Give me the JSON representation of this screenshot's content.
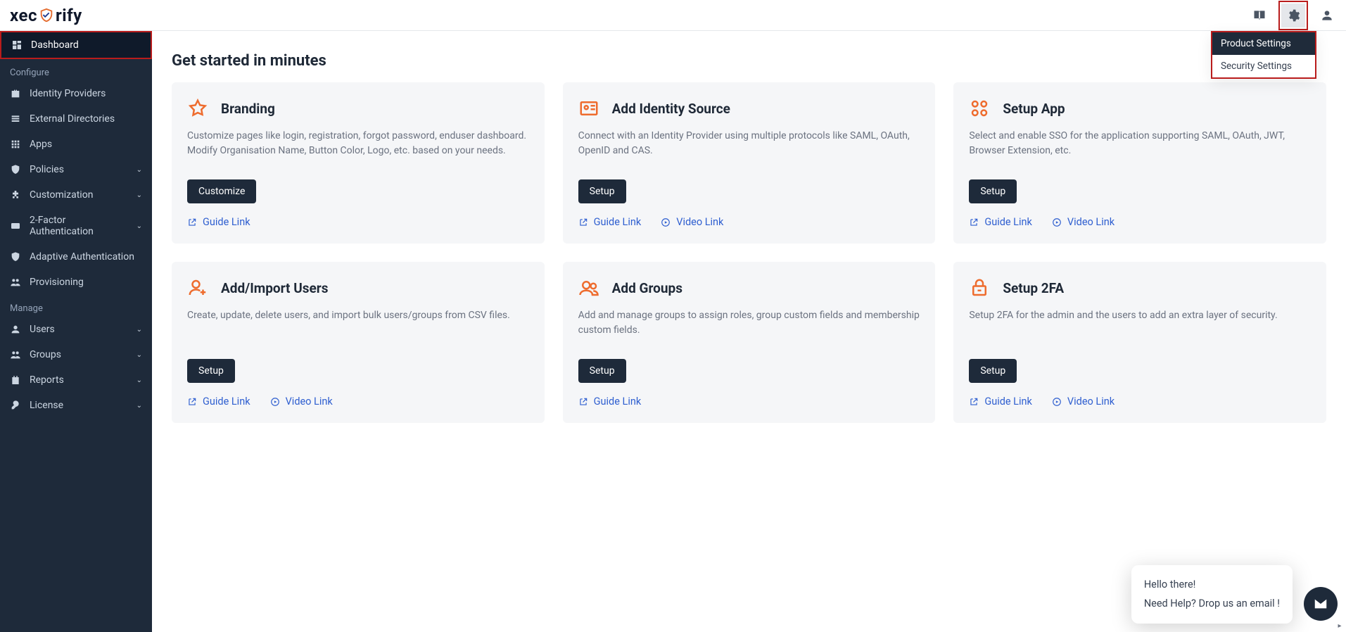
{
  "brand": {
    "name_left": "xec",
    "name_right": "rify"
  },
  "dropdown": {
    "product_settings": "Product Settings",
    "security_settings": "Security Settings"
  },
  "sidebar": {
    "dashboard_label": "Dashboard",
    "section_configure": "Configure",
    "identity_providers": "Identity Providers",
    "external_directories": "External Directories",
    "apps": "Apps",
    "policies": "Policies",
    "customization": "Customization",
    "two_factor": "2-Factor Authentication",
    "adaptive_auth": "Adaptive Authentication",
    "provisioning": "Provisioning",
    "section_manage": "Manage",
    "users": "Users",
    "groups": "Groups",
    "reports": "Reports",
    "license": "License"
  },
  "page": {
    "title": "Get started in minutes"
  },
  "cards": {
    "branding": {
      "title": "Branding",
      "desc": "Customize pages like login, registration, forgot password, enduser dashboard. Modify Organisation Name, Button Color, Logo, etc. based on your needs.",
      "btn": "Customize",
      "guide": "Guide Link"
    },
    "identity": {
      "title": "Add Identity Source",
      "desc": "Connect with an Identity Provider using multiple protocols like SAML, OAuth, OpenID and CAS.",
      "btn": "Setup",
      "guide": "Guide Link",
      "video": "Video Link"
    },
    "setup_app": {
      "title": "Setup App",
      "desc": "Select and enable SSO for the application supporting SAML, OAuth, JWT, Browser Extension, etc.",
      "btn": "Setup",
      "guide": "Guide Link",
      "video": "Video Link"
    },
    "add_users": {
      "title": "Add/Import Users",
      "desc": "Create, update, delete users, and import bulk users/groups from CSV files.",
      "btn": "Setup",
      "guide": "Guide Link",
      "video": "Video Link"
    },
    "add_groups": {
      "title": "Add Groups",
      "desc": "Add and manage groups to assign roles, group custom fields and membership custom fields.",
      "btn": "Setup",
      "guide": "Guide Link"
    },
    "setup_2fa": {
      "title": "Setup 2FA",
      "desc": "Setup 2FA for the admin and the users to add an extra layer of security.",
      "btn": "Setup",
      "guide": "Guide Link",
      "video": "Video Link"
    }
  },
  "chat": {
    "line1": "Hello there!",
    "line2": "Need Help? Drop us an email !"
  }
}
